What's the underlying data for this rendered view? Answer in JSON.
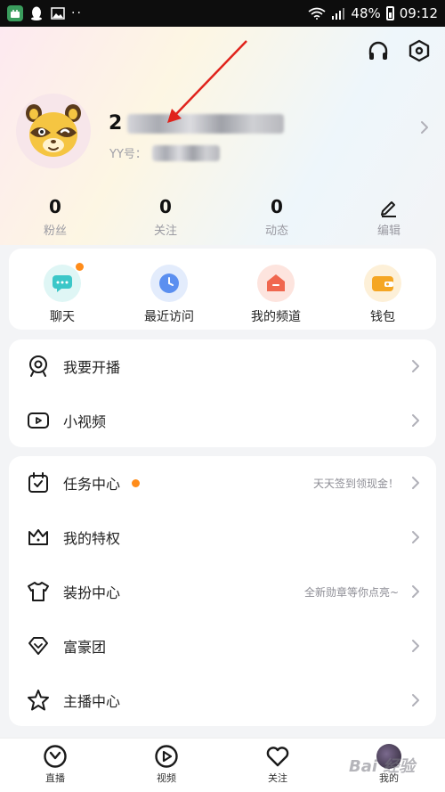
{
  "status_bar": {
    "battery": "48%",
    "time": "09:12"
  },
  "profile": {
    "nickname_prefix": "2",
    "yy_label": "YY号："
  },
  "stats": [
    {
      "value": "0",
      "label": "粉丝"
    },
    {
      "value": "0",
      "label": "关注"
    },
    {
      "value": "0",
      "label": "动态"
    },
    {
      "label": "编辑"
    }
  ],
  "quick_actions": [
    {
      "label": "聊天"
    },
    {
      "label": "最近访问"
    },
    {
      "label": "我的频道"
    },
    {
      "label": "钱包"
    }
  ],
  "menu_group_1": [
    {
      "label": "我要开播"
    },
    {
      "label": "小视频"
    }
  ],
  "menu_group_2": [
    {
      "label": "任务中心",
      "hint": "天天签到领现金！"
    },
    {
      "label": "我的特权",
      "hint": ""
    },
    {
      "label": "装扮中心",
      "hint": "全新勋章等你点亮~"
    },
    {
      "label": "富豪团",
      "hint": ""
    },
    {
      "label": "主播中心",
      "hint": ""
    }
  ],
  "tabbar": [
    {
      "label": "直播"
    },
    {
      "label": "视频"
    },
    {
      "label": "关注"
    },
    {
      "label": "我的"
    }
  ],
  "watermark": "Bai 经验",
  "colors": {
    "accent_orange": "#ff8c1a",
    "chat_teal": "#3cc7c8",
    "recent_blue": "#5b8ff0",
    "channel_red": "#f0674f",
    "wallet_orange": "#f5a623"
  }
}
